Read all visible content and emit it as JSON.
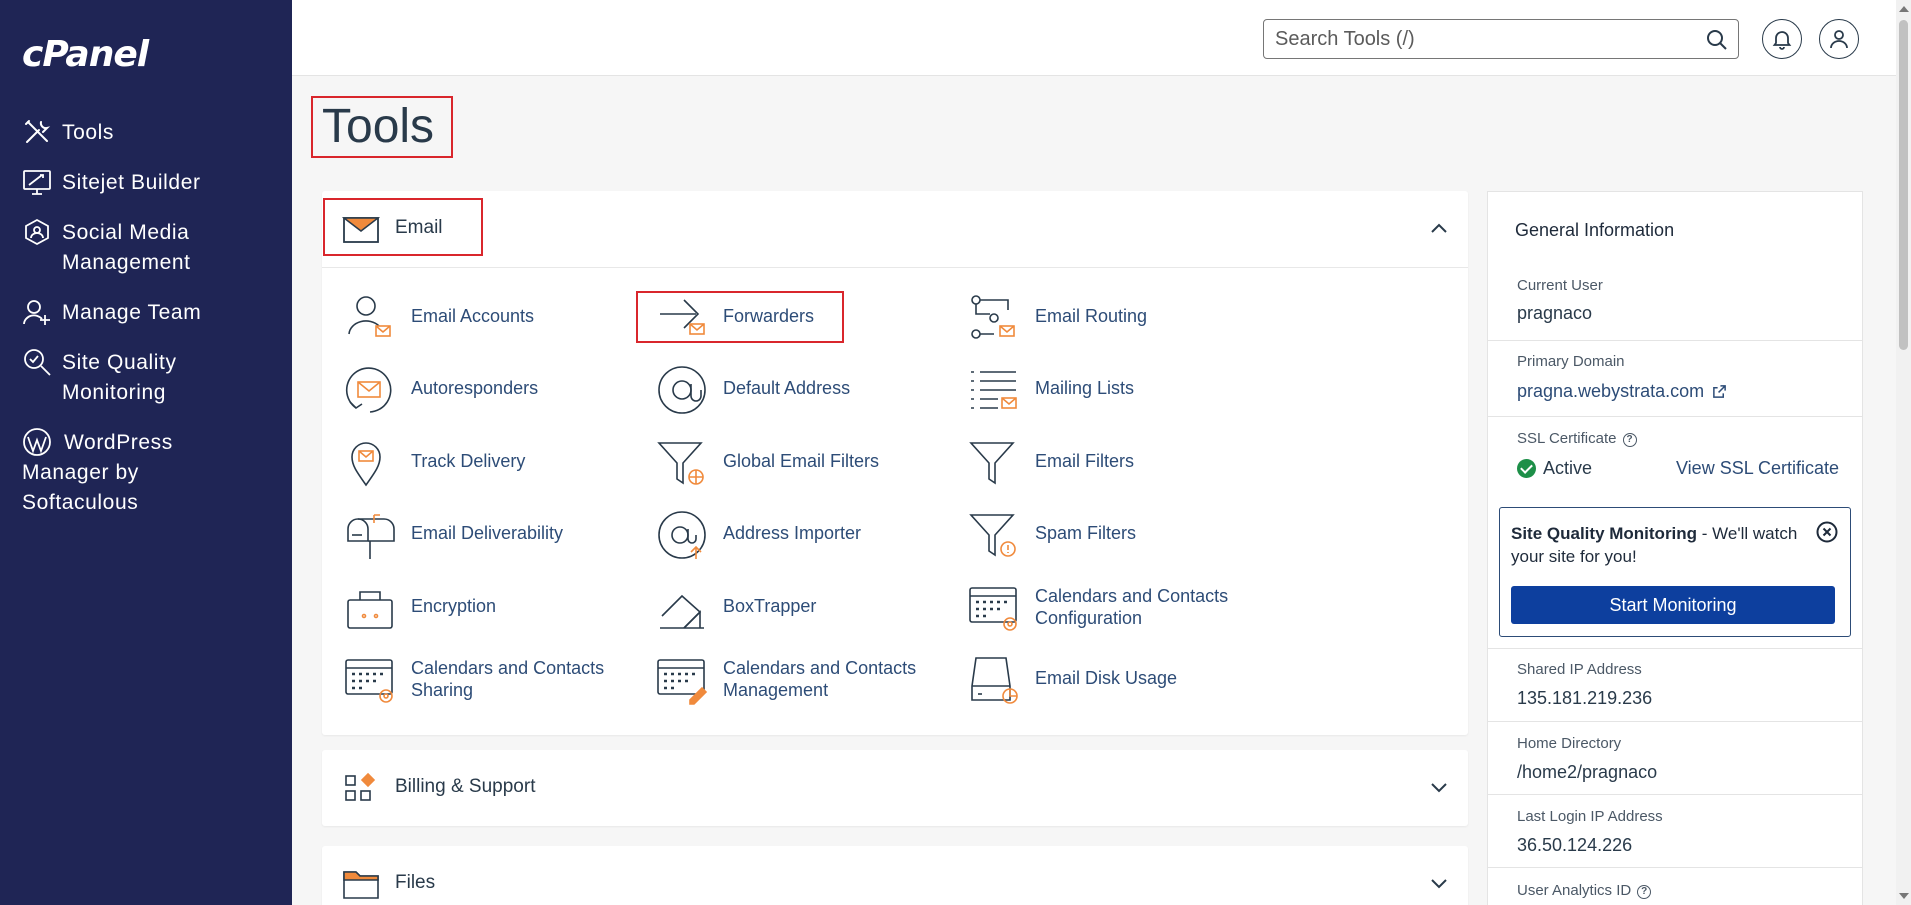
{
  "app": {
    "logo": "cPanel"
  },
  "sidebar": {
    "items": [
      {
        "label": "Tools"
      },
      {
        "label": "Sitejet Builder"
      },
      {
        "label": "Social Media\nManagement"
      },
      {
        "label": "Manage Team"
      },
      {
        "label": "Site Quality\nMonitoring"
      },
      {
        "label": "WordPress\nManager by\nSoftaculous"
      }
    ]
  },
  "topbar": {
    "search_placeholder": "Search Tools (/)"
  },
  "page": {
    "title": "Tools"
  },
  "sections": {
    "email": {
      "label": "Email",
      "tools": [
        {
          "label": "Email Accounts"
        },
        {
          "label": "Forwarders"
        },
        {
          "label": "Email Routing"
        },
        {
          "label": "Autoresponders"
        },
        {
          "label": "Default Address"
        },
        {
          "label": "Mailing Lists"
        },
        {
          "label": "Track Delivery"
        },
        {
          "label": "Global Email Filters"
        },
        {
          "label": "Email Filters"
        },
        {
          "label": "Email Deliverability"
        },
        {
          "label": "Address Importer"
        },
        {
          "label": "Spam Filters"
        },
        {
          "label": "Encryption"
        },
        {
          "label": "BoxTrapper"
        },
        {
          "label": "Calendars and Contacts Configuration"
        },
        {
          "label": "Calendars and Contacts Sharing"
        },
        {
          "label": "Calendars and Contacts Management"
        },
        {
          "label": "Email Disk Usage"
        }
      ]
    },
    "billing": {
      "label": "Billing & Support"
    },
    "files": {
      "label": "Files"
    }
  },
  "info": {
    "title": "General Information",
    "current_user_label": "Current User",
    "current_user": "pragnaco",
    "primary_domain_label": "Primary Domain",
    "primary_domain": "pragna.webystrata.com",
    "ssl_label": "SSL Certificate",
    "ssl_status": "Active",
    "ssl_link": "View SSL Certificate",
    "sqm_title": "Site Quality Monitoring",
    "sqm_text": " - We'll watch your site for you!",
    "sqm_button": "Start Monitoring",
    "shared_ip_label": "Shared IP Address",
    "shared_ip": "135.181.219.236",
    "home_dir_label": "Home Directory",
    "home_dir": "/home2/pragnaco",
    "last_login_label": "Last Login IP Address",
    "last_login": "36.50.124.226",
    "analytics_label": "User Analytics ID"
  },
  "colors": {
    "sidebar": "#1f2555",
    "accent": "#f08a3c",
    "link": "#2d4c77",
    "highlight": "#d9262c",
    "primary_button": "#0d3f9e"
  }
}
